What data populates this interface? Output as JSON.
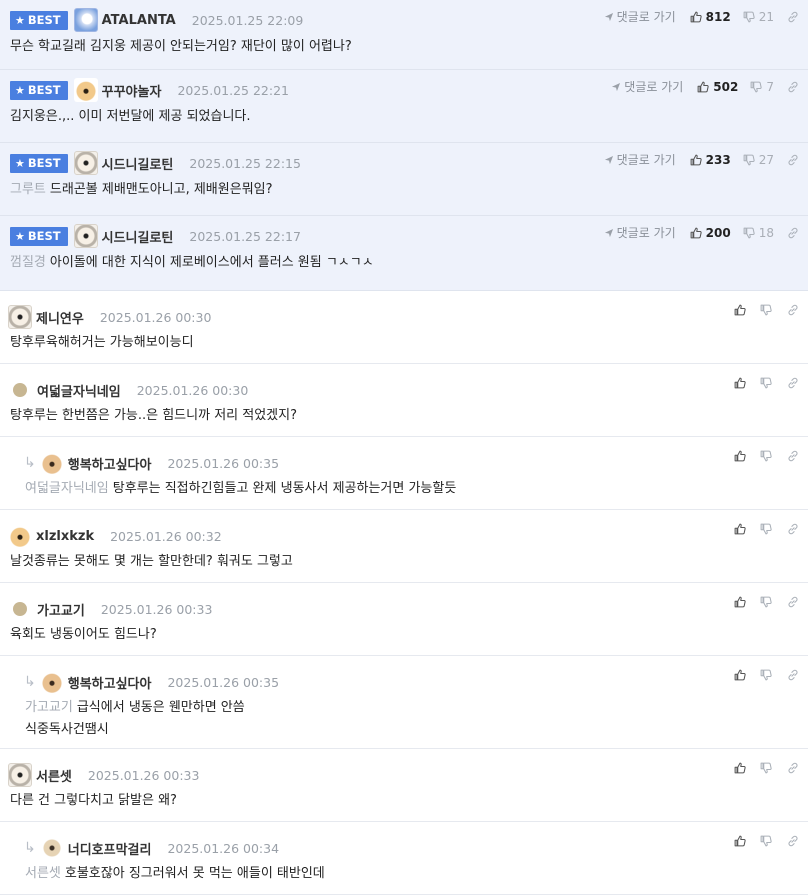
{
  "labels": {
    "best": "BEST",
    "goto_comment": "댓글로 가기"
  },
  "best": [
    {
      "nick": "ATALANTA",
      "date": "2025.01.25 22:09",
      "up": "812",
      "down": "21",
      "mention": "",
      "text": "무슨 학교길래 김지웅 제공이 안되는거임? 재단이 많이 어렵나?",
      "avatar": "blue"
    },
    {
      "nick": "꾸꾸야놀자",
      "date": "2025.01.25 22:21",
      "up": "502",
      "down": "7",
      "mention": "",
      "text": "김지웅은.,.. 이미 저번달에 제공 되었습니다.",
      "avatar": "fox"
    },
    {
      "nick": "시드니길로틴",
      "date": "2025.01.25 22:15",
      "up": "233",
      "down": "27",
      "mention": "그루트",
      "text": "드래곤볼 제배맨도아니고, 제배원은뭐임?",
      "avatar": "dog"
    },
    {
      "nick": "시드니길로틴",
      "date": "2025.01.25 22:17",
      "up": "200",
      "down": "18",
      "mention": "껌질경",
      "text": "아이돌에 대한 지식이 제로베이스에서 플러스 원됨 ㄱㅅㄱㅅ",
      "avatar": "dog"
    }
  ],
  "comments": [
    {
      "nick": "제니연우",
      "date": "2025.01.26 00:30",
      "mention": "",
      "text": "탕후루육해허거는 가능해보이능디",
      "text2": "",
      "avatar": "dog",
      "reply": false
    },
    {
      "nick": "여덟글자닉네임",
      "date": "2025.01.26 00:30",
      "mention": "",
      "text": "탕후루는 한번쯤은 가능..은 힘드니까 저리 적었겠지?",
      "text2": "",
      "avatar": "dot",
      "reply": false
    },
    {
      "nick": "행복하고싶다아",
      "date": "2025.01.26 00:35",
      "mention": "여덟글자닉네임",
      "text": "탕후루는 직접하긴힘들고 완제 냉동사서 제공하는거면 가능할듯",
      "text2": "",
      "avatar": "pup",
      "reply": true
    },
    {
      "nick": "xlzlxkzk",
      "date": "2025.01.26 00:32",
      "mention": "",
      "text": "날것종류는 못해도 몇 개는 할만한데? 훠궈도 그렇고",
      "text2": "",
      "avatar": "fox",
      "reply": false
    },
    {
      "nick": "가고교기",
      "date": "2025.01.26 00:33",
      "mention": "",
      "text": "육회도 냉동이어도 힘드나?",
      "text2": "",
      "avatar": "dot",
      "reply": false
    },
    {
      "nick": "행복하고싶다아",
      "date": "2025.01.26 00:35",
      "mention": "가고교기",
      "text": "급식에서 냉동은 웬만하면 안씀",
      "text2": "식중독사건땜시",
      "avatar": "pup",
      "reply": true
    },
    {
      "nick": "서른셋",
      "date": "2025.01.26 00:33",
      "mention": "",
      "text": "다른 건 그렇다치고 닭발은 왜?",
      "text2": "",
      "avatar": "dog",
      "reply": false
    },
    {
      "nick": "너디호프막걸리",
      "date": "2025.01.26 00:34",
      "mention": "서른셋",
      "text": "호불호잖아 징그러워서 못 먹는 애들이 태반인데",
      "text2": "",
      "avatar": "beige",
      "reply": true
    }
  ]
}
